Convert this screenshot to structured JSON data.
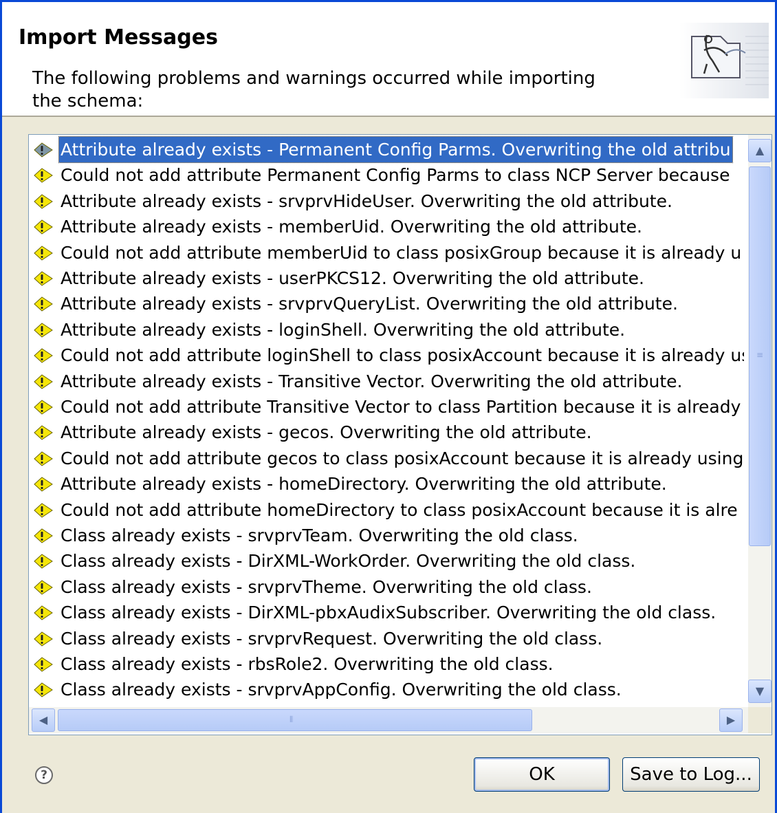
{
  "header": {
    "title": "Import Messages",
    "description": "The following problems and warnings occurred while importing the schema:",
    "icon": "schema-wizard-icon"
  },
  "messages": [
    {
      "icon": "warning-icon",
      "text": "Attribute already exists - Permanent Config Parms.  Overwriting the old attribu",
      "selected": true
    },
    {
      "icon": "warning-icon",
      "text": "Could not add attribute Permanent Config Parms to class NCP Server because"
    },
    {
      "icon": "warning-icon",
      "text": "Attribute already exists - srvprvHideUser.  Overwriting the old attribute."
    },
    {
      "icon": "warning-icon",
      "text": "Attribute already exists - memberUid.  Overwriting the old attribute."
    },
    {
      "icon": "warning-icon",
      "text": "Could not add attribute memberUid to class posixGroup because it is already u"
    },
    {
      "icon": "warning-icon",
      "text": "Attribute already exists - userPKCS12.  Overwriting the old attribute."
    },
    {
      "icon": "warning-icon",
      "text": "Attribute already exists - srvprvQueryList.  Overwriting the old attribute."
    },
    {
      "icon": "warning-icon",
      "text": "Attribute already exists - loginShell.  Overwriting the old attribute."
    },
    {
      "icon": "warning-icon",
      "text": "Could not add attribute loginShell to class posixAccount because it is already us"
    },
    {
      "icon": "warning-icon",
      "text": "Attribute already exists - Transitive Vector.  Overwriting the old attribute."
    },
    {
      "icon": "warning-icon",
      "text": "Could not add attribute Transitive Vector to class Partition because it is already"
    },
    {
      "icon": "warning-icon",
      "text": "Attribute already exists - gecos.  Overwriting the old attribute."
    },
    {
      "icon": "warning-icon",
      "text": "Could not add attribute gecos to class posixAccount because it is already using"
    },
    {
      "icon": "warning-icon",
      "text": "Attribute already exists - homeDirectory.  Overwriting the old attribute."
    },
    {
      "icon": "warning-icon",
      "text": "Could not add attribute homeDirectory to class posixAccount because it is alre"
    },
    {
      "icon": "warning-icon",
      "text": "Class already exists - srvprvTeam.  Overwriting the old class."
    },
    {
      "icon": "warning-icon",
      "text": "Class already exists - DirXML-WorkOrder.  Overwriting the old class."
    },
    {
      "icon": "warning-icon",
      "text": "Class already exists - srvprvTheme.  Overwriting the old class."
    },
    {
      "icon": "warning-icon",
      "text": "Class already exists - DirXML-pbxAudixSubscriber.  Overwriting the old class."
    },
    {
      "icon": "warning-icon",
      "text": "Class already exists - srvprvRequest.  Overwriting the old class."
    },
    {
      "icon": "warning-icon",
      "text": "Class already exists - rbsRole2.  Overwriting the old class."
    },
    {
      "icon": "warning-icon",
      "text": "Class already exists - srvprvAppConfig.  Overwriting the old class."
    }
  ],
  "scrollbars": {
    "up_icon": "chevron-up-icon",
    "down_icon": "chevron-down-icon",
    "left_icon": "chevron-left-icon",
    "right_icon": "chevron-right-icon"
  },
  "footer": {
    "help_icon": "help-icon",
    "help_glyph": "?",
    "ok_label": "OK",
    "save_label": "Save to Log..."
  },
  "colors": {
    "selection": "#316ac5",
    "warning": "#f5e60a",
    "window_frame": "#0a49d6",
    "dialog_bg": "#ece9d8"
  }
}
